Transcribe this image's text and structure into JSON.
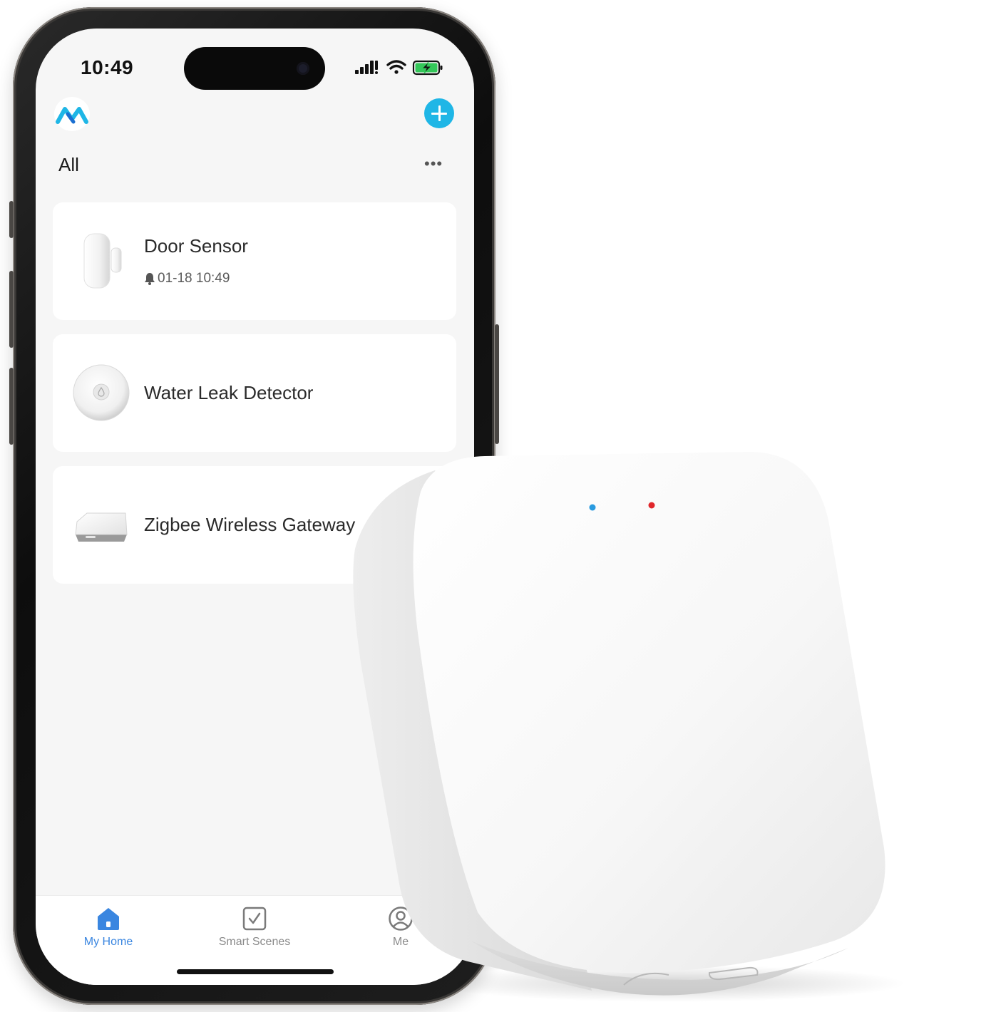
{
  "status_bar": {
    "time": "10:49",
    "icons": [
      "cellular-signal-icon",
      "wifi-icon",
      "battery-charging-icon"
    ]
  },
  "header": {
    "logo_icon": "app-logo-icon",
    "add_icon": "plus-icon"
  },
  "filter": {
    "label": "All",
    "more_label": "•••"
  },
  "devices": [
    {
      "name": "Door Sensor",
      "meta": "01-18 10:49",
      "meta_icon": "bell-icon",
      "thumb_icon": "door-sensor-icon"
    },
    {
      "name": "Water Leak Detector",
      "thumb_icon": "water-leak-detector-icon"
    },
    {
      "name": "Zigbee Wireless Gateway",
      "thumb_icon": "zigbee-gateway-icon"
    }
  ],
  "tabs": [
    {
      "label": "My Home",
      "icon": "home-icon",
      "active": true
    },
    {
      "label": "Smart Scenes",
      "icon": "checkbox-icon",
      "active": false
    },
    {
      "label": "Me",
      "icon": "profile-icon",
      "active": false
    }
  ],
  "colors": {
    "accent": "#1fb6e6",
    "tab_active": "#3a86e0",
    "led_blue": "#2a9be0",
    "led_red": "#e0262b",
    "battery_green": "#34c759"
  }
}
